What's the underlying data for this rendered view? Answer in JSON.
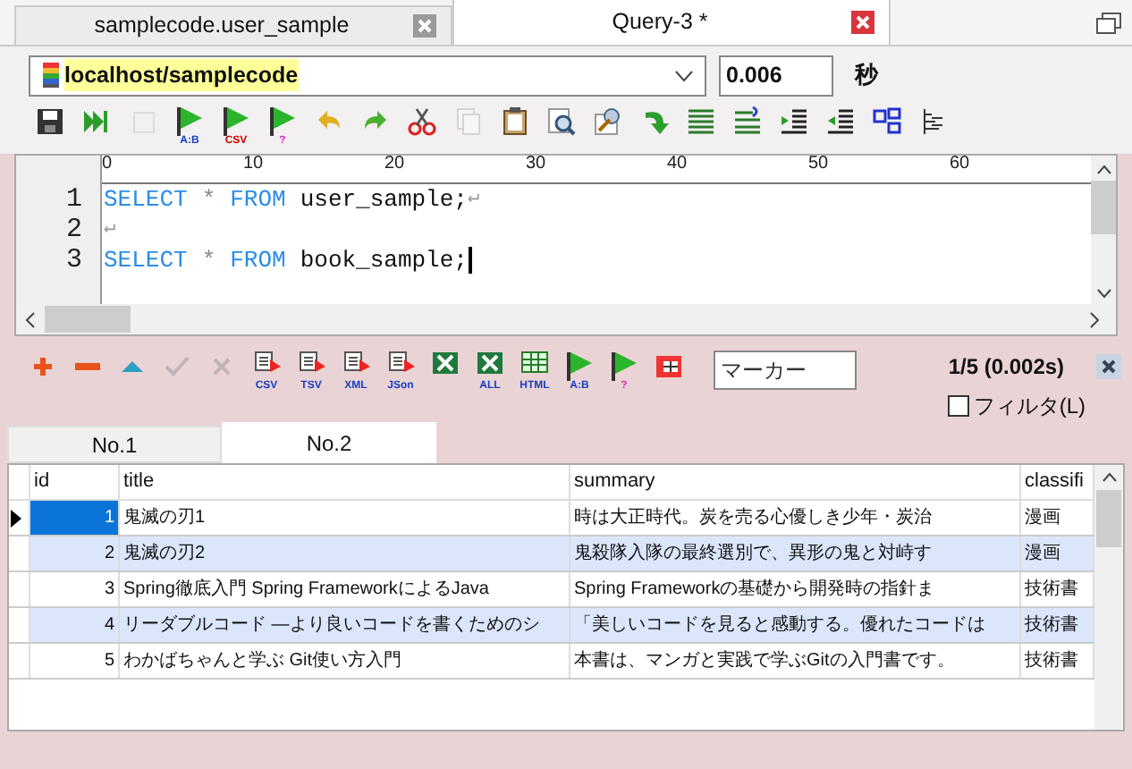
{
  "tabs": [
    {
      "label": "samplecode.user_sample",
      "selected": false
    },
    {
      "label": "Query-3 *",
      "selected": true
    }
  ],
  "connection": {
    "value": "localhost/samplecode"
  },
  "elapsed": {
    "value": "0.006",
    "unit": "秒"
  },
  "toolbar": [
    {
      "kind": "save",
      "disabled": false
    },
    {
      "kind": "run",
      "disabled": false
    },
    {
      "kind": "stop",
      "disabled": true
    },
    {
      "kind": "flag",
      "label": "A:B",
      "disabled": false
    },
    {
      "kind": "flag",
      "label": "CSV",
      "disabled": false
    },
    {
      "kind": "query",
      "label": "?",
      "disabled": false
    },
    {
      "kind": "undo",
      "disabled": false
    },
    {
      "kind": "redo",
      "disabled": false
    },
    {
      "kind": "cut",
      "disabled": false
    },
    {
      "kind": "copy",
      "disabled": true
    },
    {
      "kind": "paste",
      "disabled": false
    },
    {
      "kind": "find",
      "disabled": false
    },
    {
      "kind": "edit",
      "disabled": false
    },
    {
      "kind": "refresh",
      "disabled": false
    },
    {
      "kind": "align",
      "disabled": false
    },
    {
      "kind": "wrap",
      "disabled": false
    },
    {
      "kind": "indent",
      "disabled": false
    },
    {
      "kind": "outdent",
      "disabled": false
    },
    {
      "kind": "tree",
      "disabled": false
    },
    {
      "kind": "lines",
      "disabled": false
    }
  ],
  "editor": {
    "ruler": [
      "0",
      "10",
      "20",
      "30",
      "40",
      "50",
      "60"
    ],
    "lines": [
      {
        "number": "1",
        "tokens": [
          {
            "kind": "keyword",
            "text": "SELECT"
          },
          {
            "kind": "operator",
            "text": "*"
          },
          {
            "kind": "keyword",
            "text": "FROM"
          },
          {
            "kind": "identifier",
            "text": "user_sample;"
          }
        ],
        "eol": "↵"
      },
      {
        "number": "2",
        "eol": "↵"
      },
      {
        "number": "3",
        "tokens": [
          {
            "kind": "keyword",
            "text": "SELECT"
          },
          {
            "kind": "operator",
            "text": "*"
          },
          {
            "kind": "keyword",
            "text": "FROM"
          },
          {
            "kind": "identifier",
            "text": "book_sample;"
          }
        ],
        "cursor": true
      }
    ]
  },
  "result_toolbar": [
    {
      "kind": "plus",
      "disabled": false
    },
    {
      "kind": "minus",
      "disabled": false
    },
    {
      "kind": "up",
      "disabled": false
    },
    {
      "kind": "check",
      "disabled": true
    },
    {
      "kind": "cross",
      "disabled": true
    },
    {
      "kind": "doc",
      "label": "CSV",
      "disabled": false
    },
    {
      "kind": "doc",
      "label": "TSV",
      "disabled": false
    },
    {
      "kind": "doc",
      "label": "XML",
      "disabled": false
    },
    {
      "kind": "doc",
      "label": "JSon",
      "disabled": false
    },
    {
      "kind": "excel",
      "disabled": false
    },
    {
      "kind": "excel",
      "label": "ALL",
      "disabled": false
    },
    {
      "kind": "grid",
      "label": "HTML",
      "disabled": false
    },
    {
      "kind": "flag",
      "label": "A:B",
      "disabled": false
    },
    {
      "kind": "query",
      "label": "?",
      "disabled": false
    },
    {
      "kind": "table",
      "disabled": false
    }
  ],
  "marker": {
    "placeholder": "マーカー"
  },
  "status": "1/5 (0.002s)",
  "filter": {
    "label": "フィルタ(L)",
    "checked": false
  },
  "result_tabs": [
    {
      "label": "No.1",
      "selected": false
    },
    {
      "label": "No.2",
      "selected": true
    }
  ],
  "table": {
    "columns": [
      "id",
      "title",
      "summary",
      "classifi"
    ],
    "rows": [
      {
        "selected": true,
        "cells": [
          "1",
          "鬼滅の刃1",
          "時は大正時代。炭を売る心優しき少年・炭治",
          "漫画"
        ]
      },
      {
        "selected": false,
        "cells": [
          "2",
          "鬼滅の刃2",
          "鬼殺隊入隊の最終選別で、異形の鬼と対峙す",
          "漫画"
        ]
      },
      {
        "selected": false,
        "cells": [
          "3",
          "Spring徹底入門 Spring FrameworkによるJava",
          "Spring Frameworkの基礎から開発時の指針ま",
          "技術書"
        ]
      },
      {
        "selected": false,
        "cells": [
          "4",
          "リーダブルコード ―より良いコードを書くためのシ",
          "「美しいコードを見ると感動する。優れたコードは",
          "技術書"
        ]
      },
      {
        "selected": false,
        "cells": [
          "5",
          "わかばちゃんと学ぶ Git使い方入門",
          "本書は、マンガと実践で学ぶGitの入門書です。",
          "技術書"
        ]
      }
    ]
  }
}
